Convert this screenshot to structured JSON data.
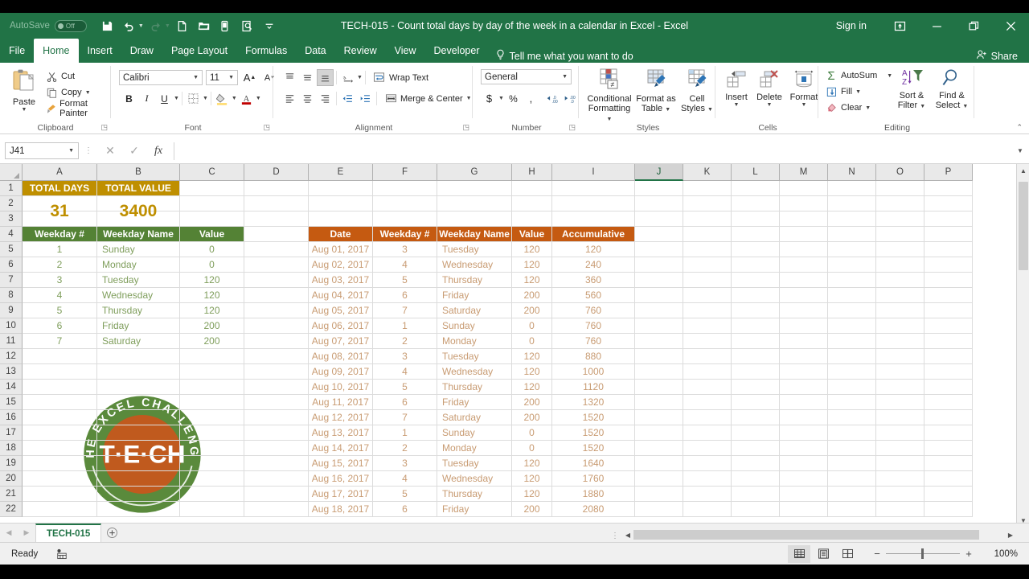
{
  "window": {
    "title": "TECH-015 - Count total days by day of the week in a calendar in Excel  -  Excel",
    "autosave_label": "AutoSave",
    "autosave_state": "Off",
    "signin": "Sign in",
    "minimize": "minimize-icon",
    "restore": "restore-icon",
    "close": "close-icon",
    "ribbon_display": "ribbon-display-options-icon"
  },
  "quick_access": [
    {
      "name": "save-icon"
    },
    {
      "name": "undo-icon"
    },
    {
      "name": "redo-icon"
    },
    {
      "name": "new-icon"
    },
    {
      "name": "open-icon"
    },
    {
      "name": "touch-mode-icon"
    },
    {
      "name": "print-preview-icon"
    },
    {
      "name": "customize-qat-icon"
    }
  ],
  "tabs": [
    {
      "label": "File",
      "active": false
    },
    {
      "label": "Home",
      "active": true
    },
    {
      "label": "Insert",
      "active": false
    },
    {
      "label": "Draw",
      "active": false
    },
    {
      "label": "Page Layout",
      "active": false
    },
    {
      "label": "Formulas",
      "active": false
    },
    {
      "label": "Data",
      "active": false
    },
    {
      "label": "Review",
      "active": false
    },
    {
      "label": "View",
      "active": false
    },
    {
      "label": "Developer",
      "active": false
    }
  ],
  "tellme": "Tell me what you want to do",
  "share": "Share",
  "ribbon": {
    "clipboard": {
      "label": "Clipboard",
      "paste": "Paste",
      "cut": "Cut",
      "copy": "Copy",
      "format_painter": "Format Painter"
    },
    "font": {
      "label": "Font",
      "family": "Calibri",
      "size": "11",
      "grow": "A",
      "shrink": "A",
      "bold": "B",
      "italic": "I",
      "underline": "U",
      "borders": "borders-icon",
      "fill": "fill-color-icon",
      "fontcolor": "font-color-icon"
    },
    "alignment": {
      "label": "Alignment",
      "wrap_text": "Wrap Text",
      "merge_center": "Merge & Center"
    },
    "number": {
      "label": "Number",
      "format": "General",
      "currency": "$",
      "percent": "%",
      "comma": ",",
      "inc_dec": ".00",
      "dec_dec": ".00"
    },
    "styles": {
      "label": "Styles",
      "conditional_formatting": "Conditional\nFormatting",
      "conditional_formatting_l1": "Conditional",
      "conditional_formatting_l2": "Formatting",
      "format_as_table_l1": "Format as",
      "format_as_table_l2": "Table",
      "cell_styles_l1": "Cell",
      "cell_styles_l2": "Styles"
    },
    "cells": {
      "label": "Cells",
      "insert": "Insert",
      "delete": "Delete",
      "format": "Format"
    },
    "editing": {
      "label": "Editing",
      "autosum": "AutoSum",
      "fill": "Fill",
      "clear": "Clear",
      "sort_filter_l1": "Sort &",
      "sort_filter_l2": "Filter",
      "find_select_l1": "Find &",
      "find_select_l2": "Select"
    },
    "collapse": "collapse-ribbon-icon"
  },
  "formula_bar": {
    "name_box": "J41",
    "cancel": "cancel-icon",
    "enter": "enter-icon",
    "fx": "fx",
    "value": ""
  },
  "grid": {
    "columns": [
      "A",
      "B",
      "C",
      "D",
      "E",
      "F",
      "G",
      "H",
      "I",
      "J",
      "K",
      "L",
      "M",
      "N",
      "O",
      "P"
    ],
    "selected_column": "J",
    "rows": [
      1,
      2,
      3,
      4,
      5,
      6,
      7,
      8,
      9,
      10,
      11,
      12,
      13,
      14,
      15,
      16,
      17,
      18,
      19,
      20,
      21,
      22
    ],
    "summary": {
      "total_days_label": "TOTAL DAYS",
      "total_value_label": "TOTAL VALUE",
      "total_days": "31",
      "total_value": "3400"
    },
    "weekday_table": {
      "headers": [
        "Weekday #",
        "Weekday Name",
        "Value"
      ],
      "rows": [
        [
          "1",
          "Sunday",
          "0"
        ],
        [
          "2",
          "Monday",
          "0"
        ],
        [
          "3",
          "Tuesday",
          "120"
        ],
        [
          "4",
          "Wednesday",
          "120"
        ],
        [
          "5",
          "Thursday",
          "120"
        ],
        [
          "6",
          "Friday",
          "200"
        ],
        [
          "7",
          "Saturday",
          "200"
        ]
      ]
    },
    "calendar_table": {
      "headers": [
        "Date",
        "Weekday #",
        "Weekday Name",
        "Value",
        "Accumulative"
      ],
      "rows": [
        [
          "Aug 01, 2017",
          "3",
          "Tuesday",
          "120",
          "120"
        ],
        [
          "Aug 02, 2017",
          "4",
          "Wednesday",
          "120",
          "240"
        ],
        [
          "Aug 03, 2017",
          "5",
          "Thursday",
          "120",
          "360"
        ],
        [
          "Aug 04, 2017",
          "6",
          "Friday",
          "200",
          "560"
        ],
        [
          "Aug 05, 2017",
          "7",
          "Saturday",
          "200",
          "760"
        ],
        [
          "Aug 06, 2017",
          "1",
          "Sunday",
          "0",
          "760"
        ],
        [
          "Aug 07, 2017",
          "2",
          "Monday",
          "0",
          "760"
        ],
        [
          "Aug 08, 2017",
          "3",
          "Tuesday",
          "120",
          "880"
        ],
        [
          "Aug 09, 2017",
          "4",
          "Wednesday",
          "120",
          "1000"
        ],
        [
          "Aug 10, 2017",
          "5",
          "Thursday",
          "120",
          "1120"
        ],
        [
          "Aug 11, 2017",
          "6",
          "Friday",
          "200",
          "1320"
        ],
        [
          "Aug 12, 2017",
          "7",
          "Saturday",
          "200",
          "1520"
        ],
        [
          "Aug 13, 2017",
          "1",
          "Sunday",
          "0",
          "1520"
        ],
        [
          "Aug 14, 2017",
          "2",
          "Monday",
          "0",
          "1520"
        ],
        [
          "Aug 15, 2017",
          "3",
          "Tuesday",
          "120",
          "1640"
        ],
        [
          "Aug 16, 2017",
          "4",
          "Wednesday",
          "120",
          "1760"
        ],
        [
          "Aug 17, 2017",
          "5",
          "Thursday",
          "120",
          "1880"
        ],
        [
          "Aug 18, 2017",
          "6",
          "Friday",
          "200",
          "2080"
        ]
      ]
    },
    "logo": {
      "arc_text": "THE EXCEL CHALLENGE",
      "center_text": "T·E·CH"
    }
  },
  "sheet_tabs": {
    "prev": "prev-sheet-icon",
    "next": "next-sheet-icon",
    "tabs": [
      {
        "label": "TECH-015",
        "active": true
      }
    ],
    "add": "add-sheet-icon"
  },
  "status_bar": {
    "state": "Ready",
    "macro_icon": "record-macro-icon",
    "views": [
      {
        "name": "normal-view-icon",
        "active": true
      },
      {
        "name": "page-layout-view-icon",
        "active": false
      },
      {
        "name": "page-break-preview-icon",
        "active": false
      }
    ],
    "zoom_out": "−",
    "zoom_in": "+",
    "zoom": "100%"
  },
  "colors": {
    "excel_green": "#217346",
    "gold_header": "#bf8f00",
    "green_header": "#548235",
    "orange_header": "#c55a11",
    "green_text": "#7f9e5c",
    "orange_text": "#c89b72"
  }
}
